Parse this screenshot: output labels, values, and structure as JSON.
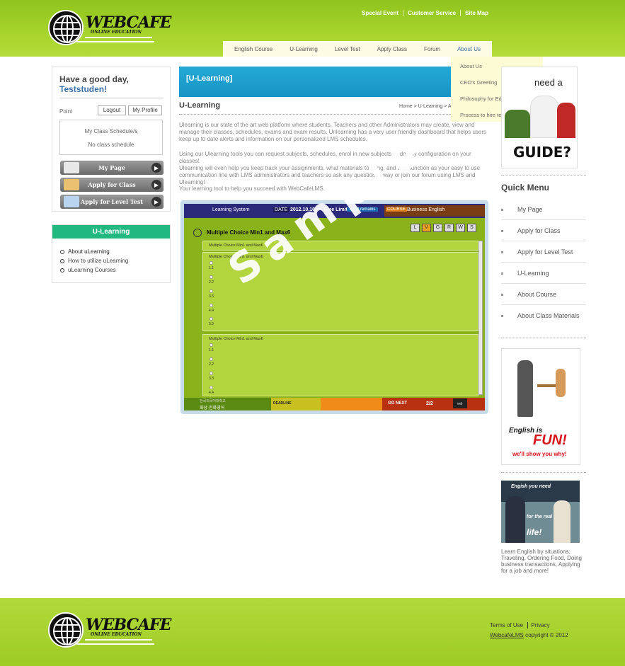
{
  "header": {
    "brand": "WEBCAFE",
    "brand_sub": "ONLINE EDUCATION",
    "top_links": [
      "Special Event",
      "Customer Service",
      "Site Map"
    ]
  },
  "nav": {
    "items": [
      "English Course",
      "U-Learning",
      "Level Test",
      "Apply Class",
      "Forum",
      "About Us"
    ],
    "active": "About Us",
    "submenu": [
      "About Us",
      "CEO's Greeting",
      "Philosophy for Education",
      "Process to hire teachers"
    ]
  },
  "user_box": {
    "greeting": "Have a good day,",
    "username": "Teststuden!",
    "point_label": "Point",
    "logout_label": "Logout",
    "profile_label": "My Profile",
    "schedule_title": "My Class Schedule/s",
    "schedule_empty": "No class schedule",
    "buttons": [
      "My Page",
      "Apply for Class",
      "Apply for Level Test"
    ]
  },
  "ulearning_box": {
    "title": "U-Learning",
    "items": [
      "About uLearning",
      "How to utilize uLearning",
      "uLearning Courses"
    ]
  },
  "content": {
    "banner_title": "[U-Learning]",
    "page_title": "U-Learning",
    "breadcrumb": "Home > U-Learning > A",
    "paragraphs": [
      "Ulearning is our state of the art web platform where students, Teachers and other Administrators may create, view and manage their classes, schedules, exams and exam results. Unlearning has a very user friendly dashboard that helps users keep up to date alerts and information on our personalized LMS schedules.",
      "Using our Ulearning tools you can request subjects, schedules, enrol in new subjects or do any configuration on your classes!",
      "Ulearning will even help you keep track your assignments, what materials to bring, and also function as your easy to use communication line with LMS administrators and teachers so ask any questions away or join our forum using LMS and Ulearning!",
      "Your learning tool to help you succeed with WebCafeLMS."
    ]
  },
  "lms_sample": {
    "system_label": "Learning System",
    "date_label": "DATE",
    "date_value": "2012.10.16",
    "time_label": "Time Limit",
    "time_value": "0:0:0 remains",
    "course_label": "COURSE",
    "course_value": "Business English",
    "question_title": "Multiple Choice Min1 and Max6",
    "toggles": [
      "L",
      "V",
      "G",
      "R",
      "W",
      "S"
    ],
    "panel_title": "Multiple Choice Min1 and Max6",
    "q1_title": "Multiple Choice Min1 and Max6",
    "q1_options": [
      "1.1",
      "2.2",
      "3.3",
      "4.4",
      "5.5"
    ],
    "q2_title": "Multiple Choice Min1 and Max6",
    "q2_options": [
      "1.1",
      "2.2",
      "3.3",
      "4.4"
    ],
    "bottom_left_1": "한국외국어대학교",
    "bottom_left_2": "화상·전화영어",
    "deadline_label": "DEADLINE",
    "next_label": "GO NEXT",
    "page_indicator": "2/2",
    "watermark": "Sample"
  },
  "right_col": {
    "guide_text1": "need a",
    "guide_text2": "GUIDE?",
    "quick_menu_title": "Quick Menu",
    "quick_items": [
      "My Page",
      "Apply for Class",
      "Apply for Level Test",
      "U-Learning",
      "About Course",
      "About Class Materials"
    ],
    "fun_text1": "English is",
    "fun_text2": "FUN!",
    "fun_text3": "we'll show you why!",
    "real_text1": "Engish you need",
    "real_text2": "for the real",
    "real_text3": "life!",
    "real_caption": "Learn English by situations; Traveling, Ordering Food, Doing business transactions, Applying for a job and more!"
  },
  "footer": {
    "terms": "Terms of Use",
    "privacy": "Privacy",
    "copyright_link": "WebcafeLMS",
    "copyright_text": "copyright © 2012"
  },
  "colors": {
    "header_green": "#a7d42c",
    "banner_blue": "#1f9fd0",
    "ulearning_green": "#22b981",
    "link_blue": "#3a6fa6"
  }
}
